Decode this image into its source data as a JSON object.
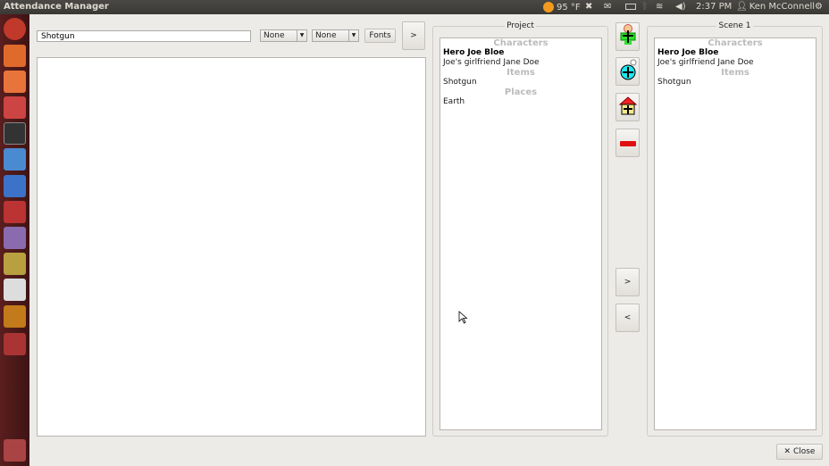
{
  "topbar": {
    "title": "Attendance Manager",
    "weather": "95 °F",
    "time": "2:37 PM",
    "user": "Ken McConnell"
  },
  "toolbar": {
    "search_value": "Shotgun",
    "combo1": "None",
    "combo2": "None",
    "fonts_label": "Fonts",
    "forward_label": ">"
  },
  "project": {
    "title": "Project",
    "sections": [
      {
        "header": "Characters",
        "items": [
          {
            "label": "Hero Joe Bloe",
            "bold": true
          },
          {
            "label": "Joe's girlfriend Jane Doe"
          }
        ]
      },
      {
        "header": "Items",
        "items": [
          {
            "label": "Shotgun"
          }
        ]
      },
      {
        "header": "Places",
        "items": [
          {
            "label": "Earth"
          }
        ]
      }
    ]
  },
  "scene": {
    "title": "Scene 1",
    "sections": [
      {
        "header": "Characters",
        "items": [
          {
            "label": "Hero Joe Bloe",
            "bold": true
          },
          {
            "label": "Joe's girlfriend Jane Doe"
          }
        ]
      },
      {
        "header": "Items",
        "items": [
          {
            "label": "Shotgun"
          }
        ]
      }
    ]
  },
  "middle": {
    "add_character": "add-character",
    "add_item": "add-item",
    "add_place": "add-place",
    "remove": "remove",
    "move_right": ">",
    "move_left": "<"
  },
  "close_label": "Close",
  "colors": {
    "launcher": "#4a1818",
    "accent": "#dd4814"
  }
}
